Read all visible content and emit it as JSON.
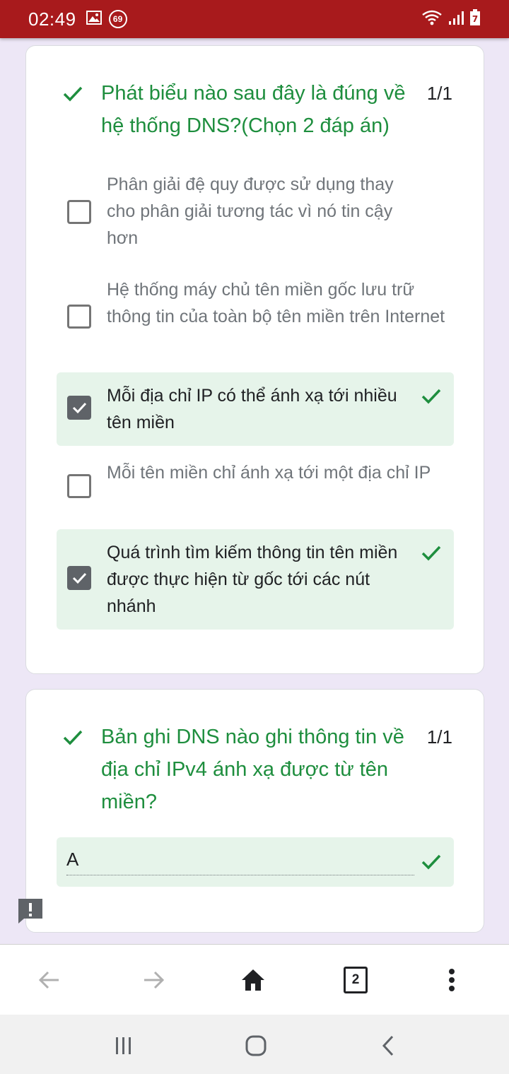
{
  "status_bar": {
    "time": "02:49",
    "notification_badge": "69",
    "battery_level": "7",
    "icons": [
      "image-icon",
      "notification-69-icon",
      "wifi-icon",
      "signal-icon",
      "battery-icon"
    ]
  },
  "questions": [
    {
      "title": "Phát biểu nào sau đây là đúng về hệ thống DNS?(Chọn 2 đáp án)",
      "score": "1/1",
      "options": [
        {
          "text": "Phân giải đệ quy được sử dụng thay cho phân giải tương tác vì nó tin cậy hơn",
          "checked": false,
          "correct": false
        },
        {
          "text": "Hệ thống máy chủ tên miền gốc lưu trữ thông tin của toàn bộ tên miền trên Internet",
          "checked": false,
          "correct": false
        },
        {
          "text": "Mỗi địa chỉ IP có thể ánh xạ tới nhiều tên miền",
          "checked": true,
          "correct": true
        },
        {
          "text": "Mỗi tên miền chỉ ánh xạ tới một địa chỉ IP",
          "checked": false,
          "correct": false
        },
        {
          "text": "Quá trình tìm kiếm thông tin tên miền được thực hiện từ gốc tới các nút nhánh",
          "checked": true,
          "correct": true
        }
      ]
    },
    {
      "title": "Bản ghi DNS nào ghi thông tin về địa chỉ IPv4 ánh xạ được từ tên miền?",
      "score": "1/1",
      "answer": "A"
    }
  ],
  "browser_toolbar": {
    "tab_count": "2",
    "buttons": [
      "back-arrow-icon",
      "forward-arrow-icon",
      "home-icon",
      "tab-switcher",
      "more-menu-icon"
    ]
  },
  "colors": {
    "status_bar": "#a81a1c",
    "correct_green": "#1e8e3e",
    "correct_bg": "#e6f4ea",
    "page_bg": "#ede7f6"
  }
}
